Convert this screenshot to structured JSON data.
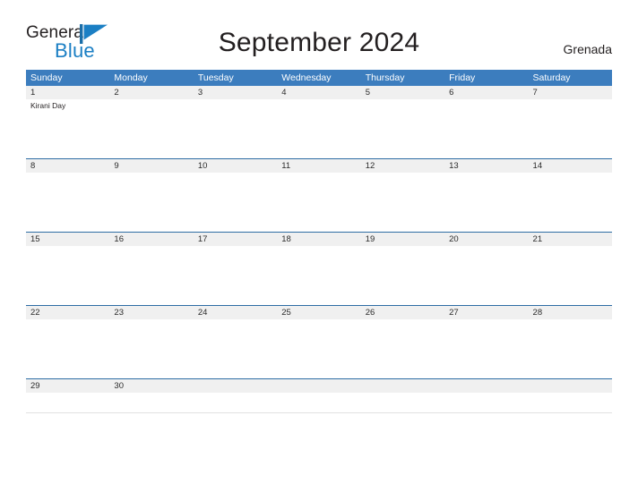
{
  "brand": {
    "name_part1": "General",
    "name_part2": "Blue",
    "flag_icon": "blue-flag-triangle-icon",
    "accent_color": "#1b7fc4"
  },
  "header": {
    "title": "September 2024",
    "country": "Grenada"
  },
  "colors": {
    "header_blue": "#3c7dbe",
    "separator_blue": "#2e6da4",
    "date_strip_gray": "#f0f0f0",
    "text_dark": "#231f20"
  },
  "calendar": {
    "month": "September",
    "year": "2024",
    "day_headers": [
      "Sunday",
      "Monday",
      "Tuesday",
      "Wednesday",
      "Thursday",
      "Friday",
      "Saturday"
    ],
    "weeks": [
      {
        "days": [
          {
            "date": "1",
            "events": [
              "Kirani Day"
            ]
          },
          {
            "date": "2",
            "events": []
          },
          {
            "date": "3",
            "events": []
          },
          {
            "date": "4",
            "events": []
          },
          {
            "date": "5",
            "events": []
          },
          {
            "date": "6",
            "events": []
          },
          {
            "date": "7",
            "events": []
          }
        ]
      },
      {
        "days": [
          {
            "date": "8",
            "events": []
          },
          {
            "date": "9",
            "events": []
          },
          {
            "date": "10",
            "events": []
          },
          {
            "date": "11",
            "events": []
          },
          {
            "date": "12",
            "events": []
          },
          {
            "date": "13",
            "events": []
          },
          {
            "date": "14",
            "events": []
          }
        ]
      },
      {
        "days": [
          {
            "date": "15",
            "events": []
          },
          {
            "date": "16",
            "events": []
          },
          {
            "date": "17",
            "events": []
          },
          {
            "date": "18",
            "events": []
          },
          {
            "date": "19",
            "events": []
          },
          {
            "date": "20",
            "events": []
          },
          {
            "date": "21",
            "events": []
          }
        ]
      },
      {
        "days": [
          {
            "date": "22",
            "events": []
          },
          {
            "date": "23",
            "events": []
          },
          {
            "date": "24",
            "events": []
          },
          {
            "date": "25",
            "events": []
          },
          {
            "date": "26",
            "events": []
          },
          {
            "date": "27",
            "events": []
          },
          {
            "date": "28",
            "events": []
          }
        ]
      },
      {
        "days": [
          {
            "date": "29",
            "events": []
          },
          {
            "date": "30",
            "events": []
          },
          {
            "date": "",
            "events": []
          },
          {
            "date": "",
            "events": []
          },
          {
            "date": "",
            "events": []
          },
          {
            "date": "",
            "events": []
          },
          {
            "date": "",
            "events": []
          }
        ]
      }
    ]
  }
}
